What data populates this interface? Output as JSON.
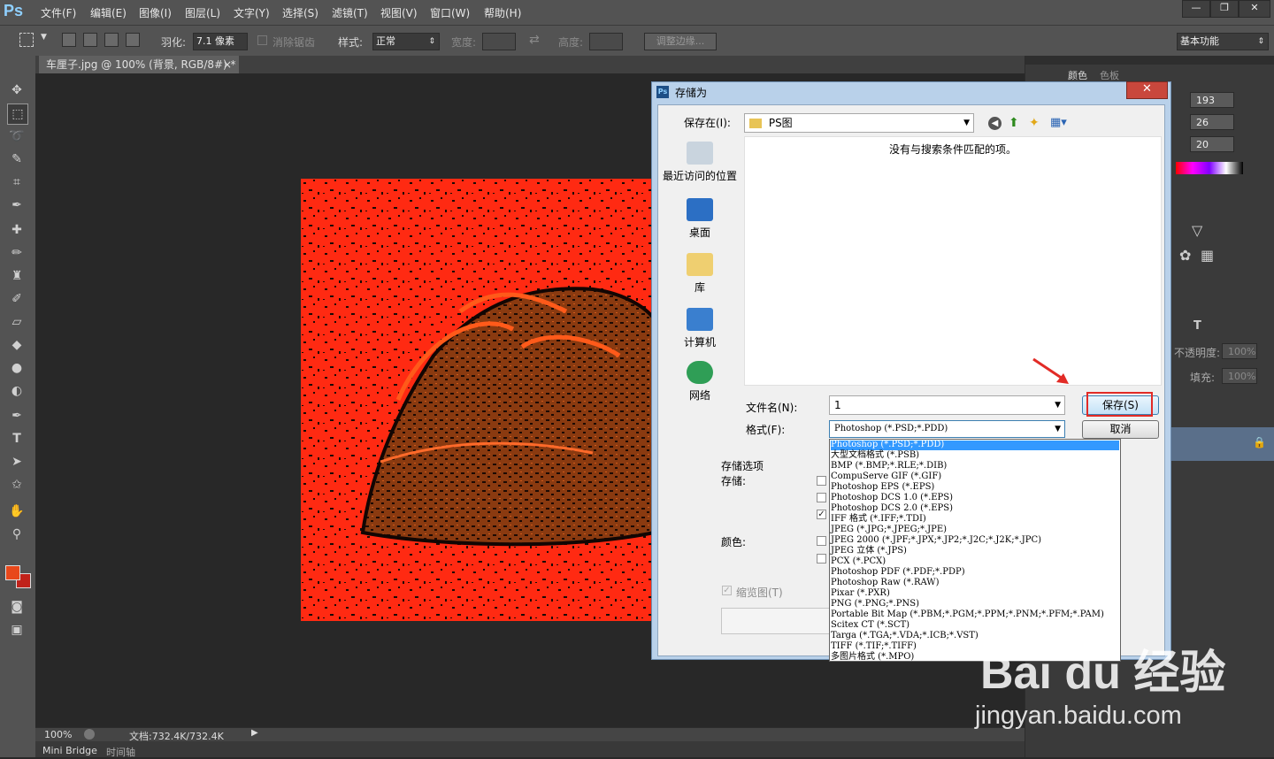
{
  "app": {
    "logo": "Ps"
  },
  "menubar": {
    "items": [
      "文件(F)",
      "编辑(E)",
      "图像(I)",
      "图层(L)",
      "文字(Y)",
      "选择(S)",
      "滤镜(T)",
      "视图(V)",
      "窗口(W)",
      "帮助(H)"
    ],
    "window_buttons": [
      "—",
      "❐",
      "✕"
    ]
  },
  "options": {
    "feather_label": "羽化:",
    "feather_value": "7.1 像素",
    "antialias_label": "消除锯齿",
    "style_label": "样式:",
    "style_value": "正常",
    "width_label": "宽度:",
    "height_label": "高度:",
    "refine_edge_button": "调整边缘...",
    "workspace_value": "基本功能"
  },
  "document": {
    "tab_title": "车厘子.jpg @ 100% (背景, RGB/8#) *",
    "tab_close": "×"
  },
  "status": {
    "zoom": "100%",
    "doc_size": "文档:732.4K/732.4K"
  },
  "bottom_tabs": [
    "Mini Bridge",
    "时间轴"
  ],
  "right_panel": {
    "tabs": [
      "颜色",
      "色板"
    ],
    "r_value": "193",
    "g_value": "26",
    "b_value": "20",
    "opacity_label": "不透明度:",
    "opacity_value": "100%",
    "fill_label": "填充:",
    "fill_value": "100%"
  },
  "dialog": {
    "title": "存储为",
    "close": "✕",
    "save_in_label": "保存在(I):",
    "save_in_value": "PS图",
    "empty_message": "没有与搜索条件匹配的项。",
    "places": [
      "最近访问的位置",
      "桌面",
      "库",
      "计算机",
      "网络"
    ],
    "filename_label": "文件名(N):",
    "filename_value": "1",
    "format_label": "格式(F):",
    "format_value": "Photoshop (*.PSD;*.PDD)",
    "save_button": "保存(S)",
    "cancel_button": "取消",
    "save_options_label": "存储选项",
    "save_label": "存储:",
    "color_label": "颜色:",
    "thumbnail_label": "缩览图(T)",
    "format_options": [
      "Photoshop (*.PSD;*.PDD)",
      "大型文档格式 (*.PSB)",
      "BMP (*.BMP;*.RLE;*.DIB)",
      "CompuServe GIF (*.GIF)",
      "Photoshop EPS (*.EPS)",
      "Photoshop DCS 1.0 (*.EPS)",
      "Photoshop DCS 2.0 (*.EPS)",
      "IFF 格式 (*.IFF;*.TDI)",
      "JPEG (*.JPG;*.JPEG;*.JPE)",
      "JPEG 2000 (*.JPF;*.JPX;*.JP2;*.J2C;*.J2K;*.JPC)",
      "JPEG 立体 (*.JPS)",
      "PCX (*.PCX)",
      "Photoshop PDF (*.PDF;*.PDP)",
      "Photoshop Raw (*.RAW)",
      "Pixar (*.PXR)",
      "PNG (*.PNG;*.PNS)",
      "Portable Bit Map (*.PBM;*.PGM;*.PPM;*.PNM;*.PFM;*.PAM)",
      "Scitex CT (*.SCT)",
      "Targa (*.TGA;*.VDA;*.ICB;*.VST)",
      "TIFF (*.TIF;*.TIFF)",
      "多图片格式 (*.MPO)"
    ]
  },
  "watermark": {
    "brand": "Bai du 经验",
    "url": "jingyan.baidu.com"
  },
  "colors": {
    "accent_red": "#e22b26",
    "selection_blue": "#3399ff",
    "foreground": "#e8481b",
    "background": "#c1221a"
  }
}
